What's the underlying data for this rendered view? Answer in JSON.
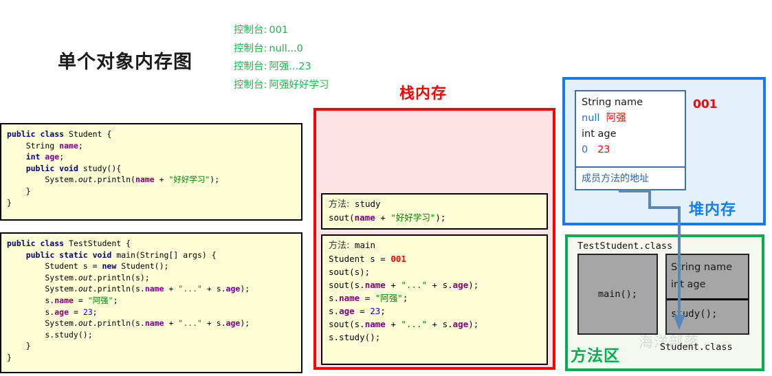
{
  "page": {
    "title": "单个对象内存图",
    "watermark": "海洋部落"
  },
  "console": {
    "label": "控制台:",
    "lines": [
      {
        "label": "控制台:",
        "value": "001"
      },
      {
        "label": "控制台:",
        "value": "null...0"
      },
      {
        "label": "控制台:",
        "value": "阿强...23"
      },
      {
        "label": "控制台:",
        "value": "阿强好好学习"
      }
    ]
  },
  "code": {
    "student": {
      "filename": "Student",
      "lines": [
        "public class Student {",
        "    String name;",
        "    int age;",
        "    public void study(){",
        "        System.out.println(name + \"好好学习\");",
        "    }",
        "}"
      ]
    },
    "test": {
      "filename": "TestStudent",
      "lines": [
        "public class TestStudent {",
        "    public static void main(String[] args) {",
        "        Student s = new Student();",
        "        System.out.println(s);",
        "        System.out.println(s.name + \"...\" + s.age);",
        "        s.name = \"阿强\";",
        "        s.age = 23;",
        "        System.out.println(s.name + \"...\" + s.age);",
        "        s.study();",
        "    }",
        "}"
      ]
    }
  },
  "stack": {
    "label": "栈内存",
    "color": "#ff0000",
    "frames": [
      {
        "header_key": "方法:",
        "header_value": "study",
        "lines": [
          "sout(name + \"好好学习\");"
        ]
      },
      {
        "header_key": "方法:",
        "header_value": "main",
        "lines": [
          "Student s = 001",
          "sout(s);",
          "sout(s.name + \"...\" + s.age);",
          "s.name = \"阿强\";",
          "s.age = 23;",
          "sout(s.name + \"...\" + s.age);",
          "s.study();"
        ],
        "ref_value": "001"
      }
    ]
  },
  "heap": {
    "label": "堆内存",
    "color": "#0d7ffa",
    "object_id": "001",
    "fields": [
      {
        "declaration": "String name",
        "initial": "null",
        "updated": "阿强"
      },
      {
        "declaration": "int age",
        "initial": "0",
        "updated": "23"
      }
    ],
    "methods_ref": "成员方法的地址"
  },
  "method_area": {
    "label": "方法区",
    "color": "#00b050",
    "classes": [
      {
        "name": "TestStudent.class",
        "members": [
          "main();"
        ]
      },
      {
        "name": "Student.class",
        "fields": [
          "String name",
          "int age"
        ],
        "members": [
          "study();"
        ]
      }
    ]
  }
}
